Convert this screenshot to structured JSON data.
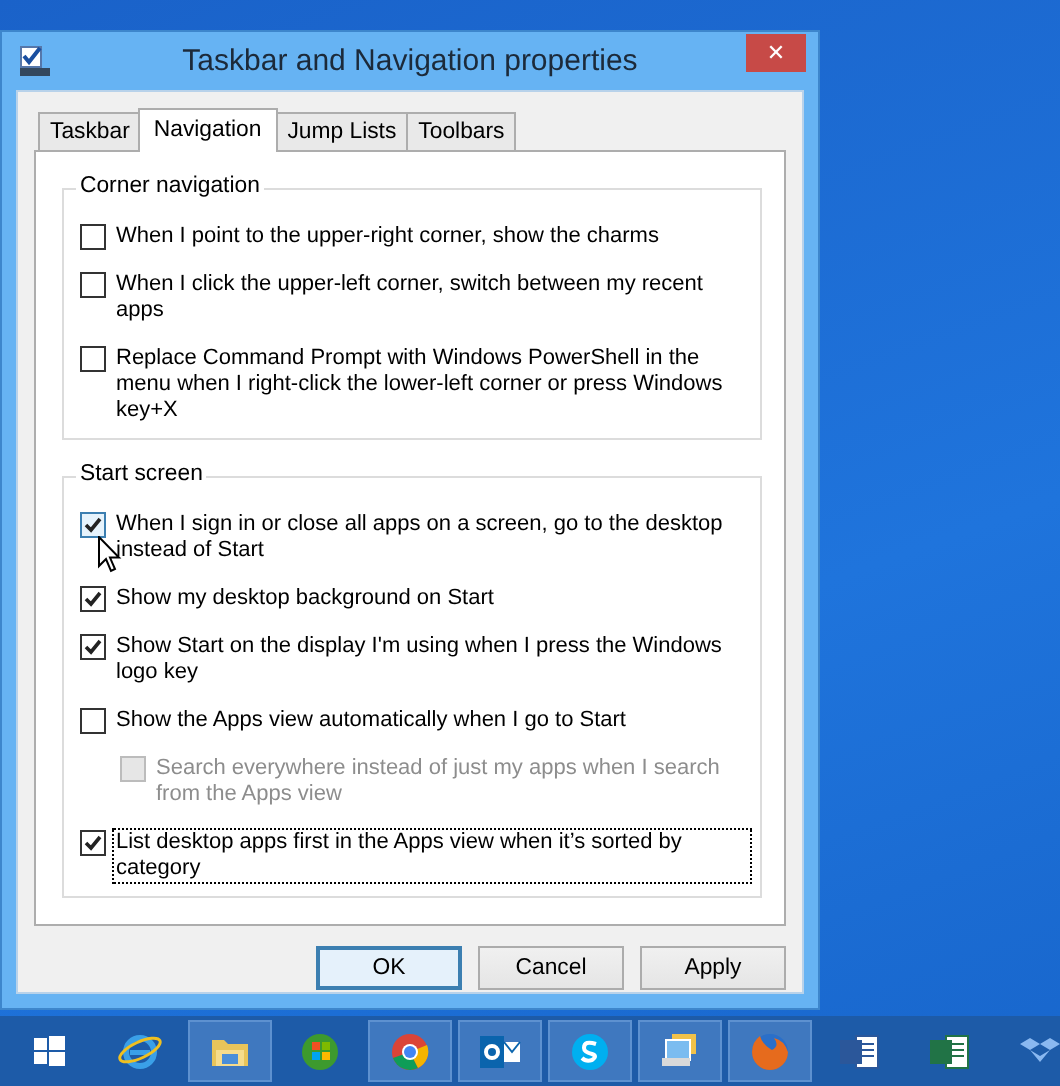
{
  "window": {
    "title": "Taskbar and Navigation properties",
    "close_glyph": "✕"
  },
  "tabs": [
    {
      "label": "Taskbar",
      "selected": false
    },
    {
      "label": "Navigation",
      "selected": true
    },
    {
      "label": "Jump Lists",
      "selected": false
    },
    {
      "label": "Toolbars",
      "selected": false
    }
  ],
  "groups": [
    {
      "title": "Corner navigation",
      "options": [
        {
          "label": "When I point to the upper-right corner, show the charms",
          "checked": false,
          "disabled": false,
          "indented": false,
          "focused": false,
          "hot": false
        },
        {
          "label": "When I click the upper-left corner, switch between my recent apps",
          "checked": false,
          "disabled": false,
          "indented": false,
          "focused": false,
          "hot": false
        },
        {
          "label": "Replace Command Prompt with Windows PowerShell in the menu when I right-click the lower-left corner or press Windows key+X",
          "checked": false,
          "disabled": false,
          "indented": false,
          "focused": false,
          "hot": false
        }
      ]
    },
    {
      "title": "Start screen",
      "options": [
        {
          "label": "When I sign in or close all apps on a screen, go to the desktop instead of Start",
          "checked": true,
          "disabled": false,
          "indented": false,
          "focused": false,
          "hot": true
        },
        {
          "label": "Show my desktop background on Start",
          "checked": true,
          "disabled": false,
          "indented": false,
          "focused": false,
          "hot": false
        },
        {
          "label": "Show Start on the display I'm using when I press the Windows logo key",
          "checked": true,
          "disabled": false,
          "indented": false,
          "focused": false,
          "hot": false
        },
        {
          "label": "Show the Apps view automatically when I go to Start",
          "checked": false,
          "disabled": false,
          "indented": false,
          "focused": false,
          "hot": false
        },
        {
          "label": "Search everywhere instead of just my apps when I search from the Apps view",
          "checked": false,
          "disabled": true,
          "indented": true,
          "focused": false,
          "hot": false
        },
        {
          "label": "List desktop apps first in the Apps view when it’s sorted by category",
          "checked": true,
          "disabled": false,
          "indented": false,
          "focused": true,
          "hot": false
        }
      ]
    }
  ],
  "buttons": [
    {
      "label": "OK",
      "default": true
    },
    {
      "label": "Cancel",
      "default": false
    },
    {
      "label": "Apply",
      "default": false
    }
  ],
  "taskbar": {
    "items": [
      {
        "kind": "start",
        "running": false
      },
      {
        "kind": "browser-e",
        "running": false
      },
      {
        "kind": "folder",
        "running": true
      },
      {
        "kind": "orb",
        "running": false
      },
      {
        "kind": "chrome",
        "running": true
      },
      {
        "kind": "mail",
        "running": true
      },
      {
        "kind": "chat",
        "running": true
      },
      {
        "kind": "windows",
        "running": true
      },
      {
        "kind": "fox",
        "running": true
      },
      {
        "kind": "doc-blue",
        "running": false
      },
      {
        "kind": "doc-green",
        "running": false
      },
      {
        "kind": "box",
        "running": false
      }
    ]
  }
}
